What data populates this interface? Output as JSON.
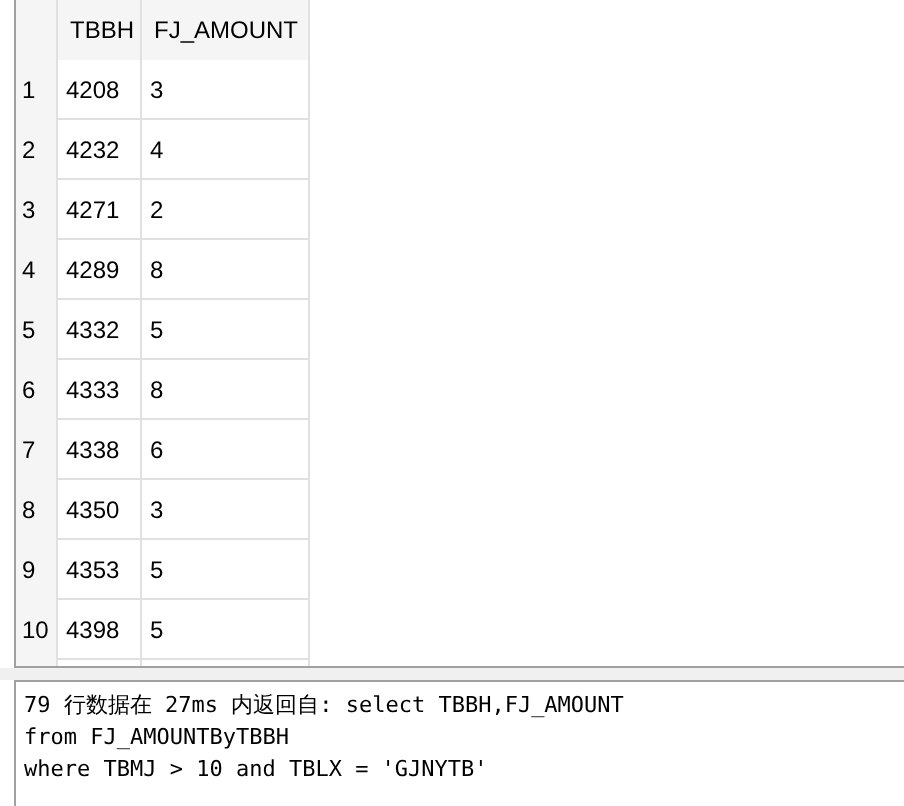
{
  "table": {
    "columns": [
      "TBBH",
      "FJ_AMOUNT"
    ],
    "rows": [
      {
        "number": "1",
        "cells": [
          "4208",
          "3"
        ]
      },
      {
        "number": "2",
        "cells": [
          "4232",
          "4"
        ]
      },
      {
        "number": "3",
        "cells": [
          "4271",
          "2"
        ]
      },
      {
        "number": "4",
        "cells": [
          "4289",
          "8"
        ]
      },
      {
        "number": "5",
        "cells": [
          "4332",
          "5"
        ]
      },
      {
        "number": "6",
        "cells": [
          "4333",
          "8"
        ]
      },
      {
        "number": "7",
        "cells": [
          "4338",
          "6"
        ]
      },
      {
        "number": "8",
        "cells": [
          "4350",
          "3"
        ]
      },
      {
        "number": "9",
        "cells": [
          "4353",
          "5"
        ]
      },
      {
        "number": "10",
        "cells": [
          "4398",
          "5"
        ]
      }
    ]
  },
  "messages": [
    "79 行数据在 27ms 内返回自: select TBBH,FJ_AMOUNT",
    "from FJ_AMOUNTByTBBH",
    "where TBMJ > 10 and TBLX = 'GJNYTB'"
  ]
}
